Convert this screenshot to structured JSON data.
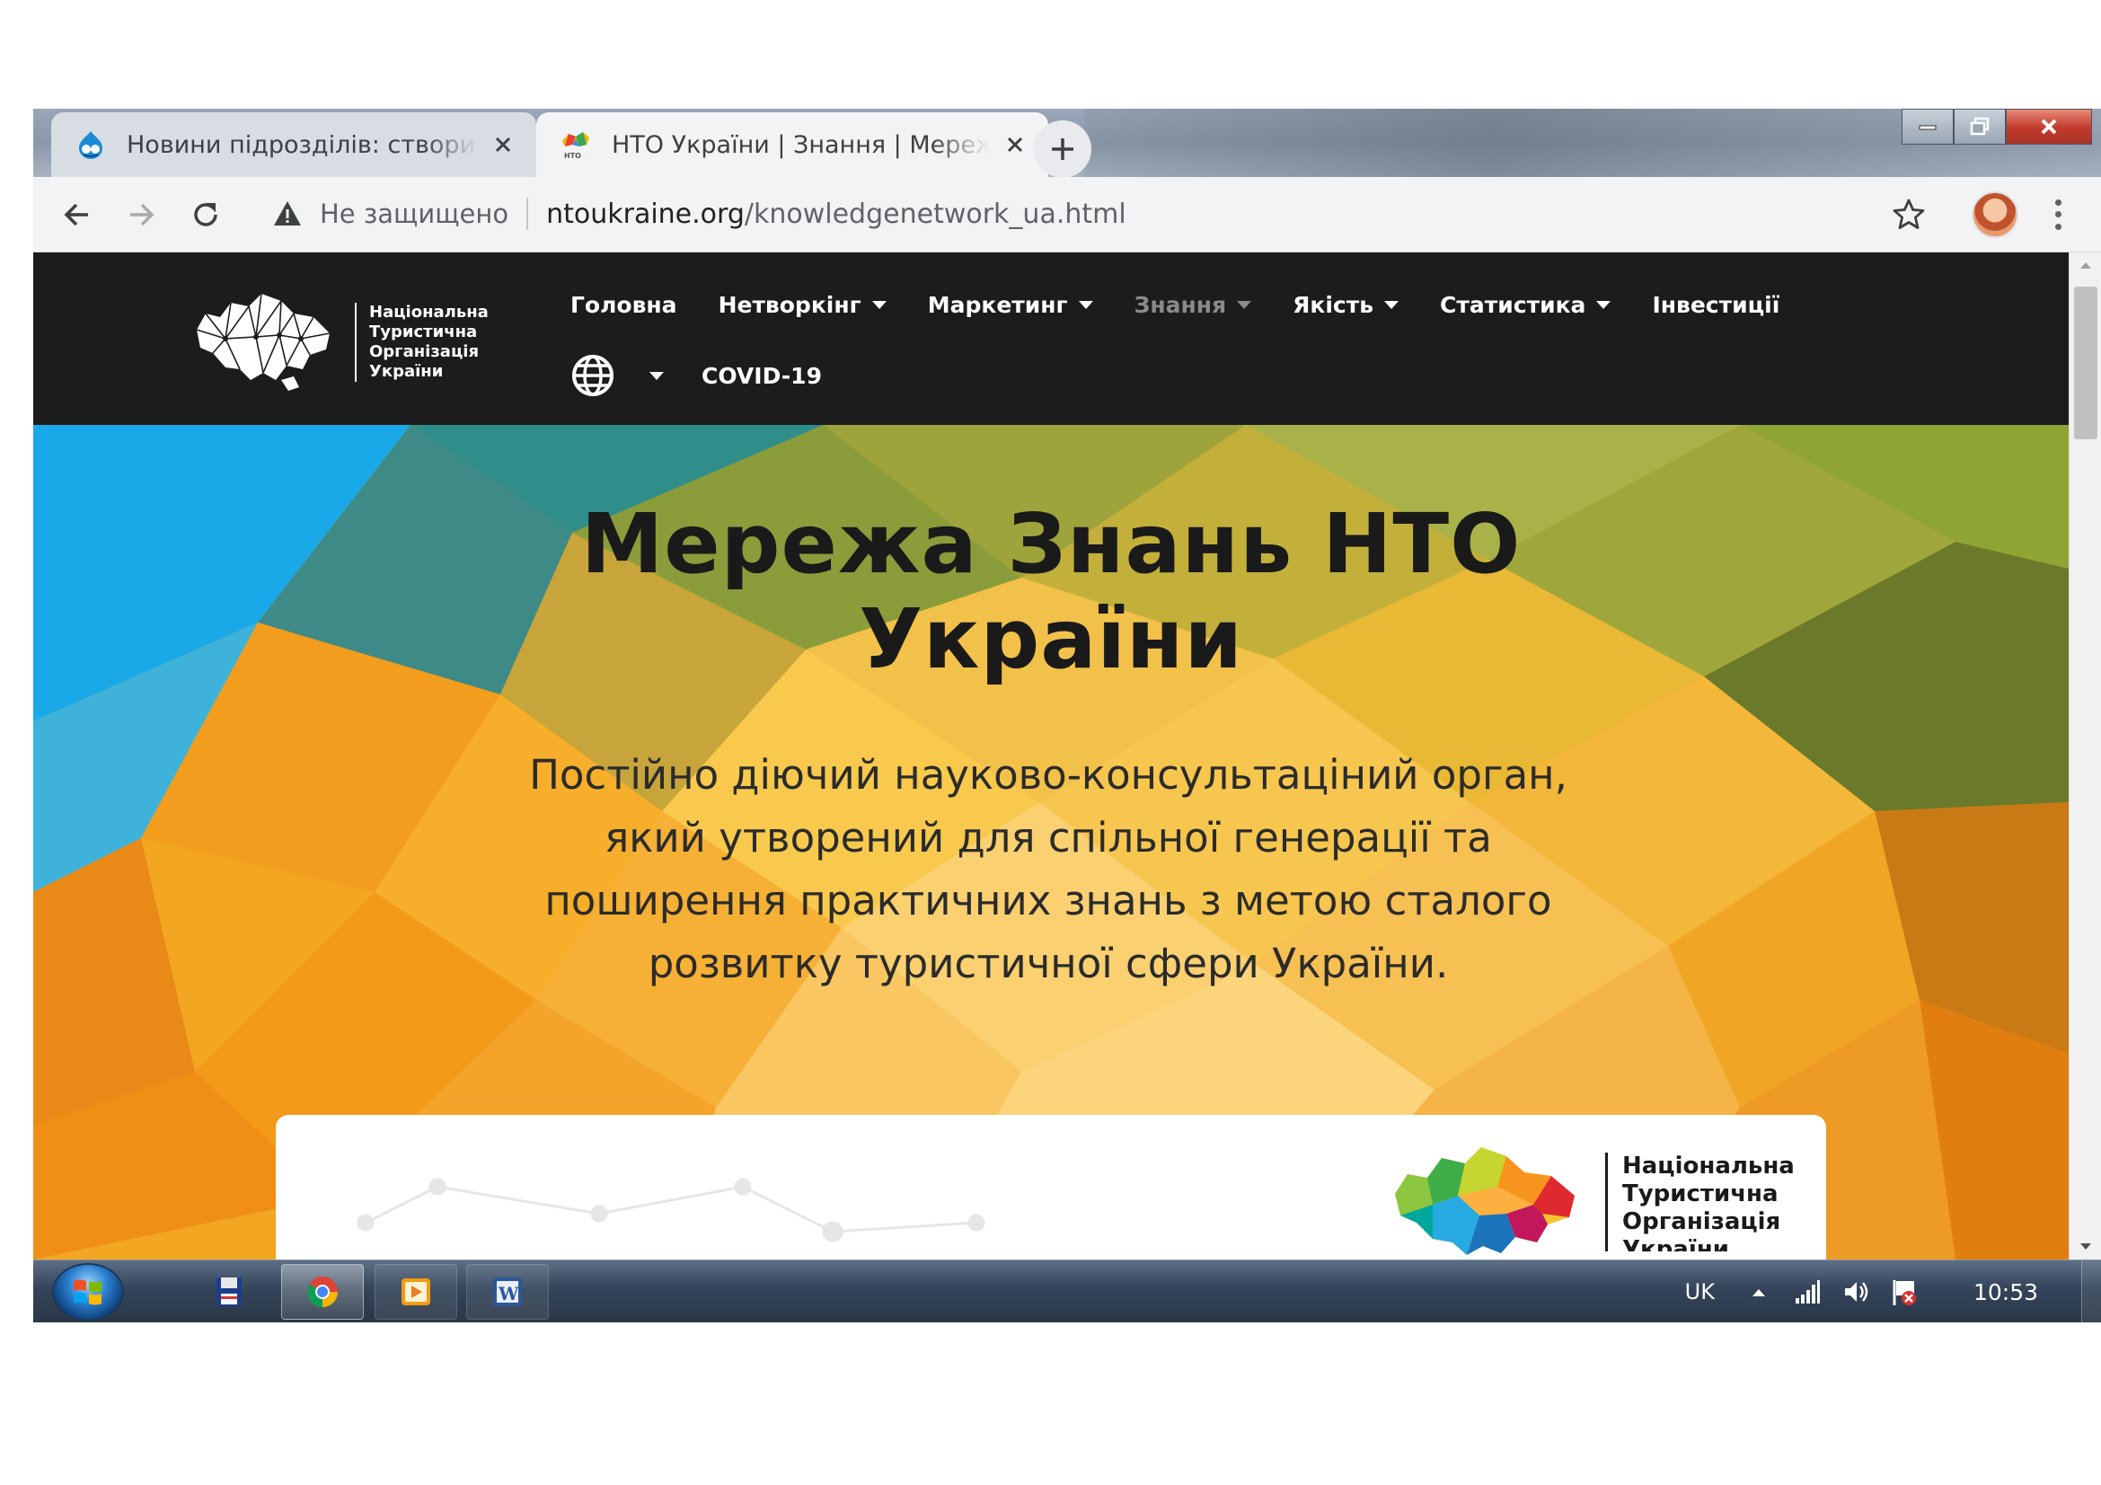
{
  "browser": {
    "tabs": [
      {
        "title": "Новини підрозділів: створити | Т",
        "favicon": "drupal-icon",
        "active": false
      },
      {
        "title": "НТО України | Знання | Мережа",
        "favicon": "nto-logo-icon",
        "active": true
      }
    ],
    "address": {
      "security_label": "Не защищено",
      "url_domain": "ntoukraine.org",
      "url_path": "/knowledgenetwork_ua.html"
    }
  },
  "site": {
    "logo_text": [
      "Національна",
      "Туристична",
      "Організація",
      "України"
    ],
    "nav_row1": [
      {
        "label": "Головна",
        "dropdown": false,
        "active": false
      },
      {
        "label": "Нетворкінг",
        "dropdown": true,
        "active": false
      },
      {
        "label": "Маркетинг",
        "dropdown": true,
        "active": false
      },
      {
        "label": "Знання",
        "dropdown": true,
        "active": true
      },
      {
        "label": "Якість",
        "dropdown": true,
        "active": false
      },
      {
        "label": "Статистика",
        "dropdown": true,
        "active": false
      },
      {
        "label": "Інвестиції",
        "dropdown": false,
        "active": false
      }
    ],
    "nav_row2_link": "COVID-19",
    "hero": {
      "title_line1": "Мережа Знань НТО",
      "title_line2": "України",
      "description": [
        "Постійно діючий науково-консультаціний орган,",
        "який утворений для спільної генерації та",
        "поширення практичних знань з метою сталого",
        "розвитку туристичної сфери України."
      ]
    },
    "card_logo_text": [
      "Національна",
      "Туристична",
      "Організація",
      "України"
    ]
  },
  "taskbar": {
    "language": "UK",
    "clock": "10:53",
    "apps": [
      "disk-icon",
      "chrome-icon",
      "media-player-icon",
      "word-icon"
    ]
  },
  "colors": {
    "header_bg": "#1c1c1c",
    "nav_active": "#8a8a8a",
    "hero_yellow": "#f2b32a",
    "hero_blue": "#1ea7e6"
  }
}
